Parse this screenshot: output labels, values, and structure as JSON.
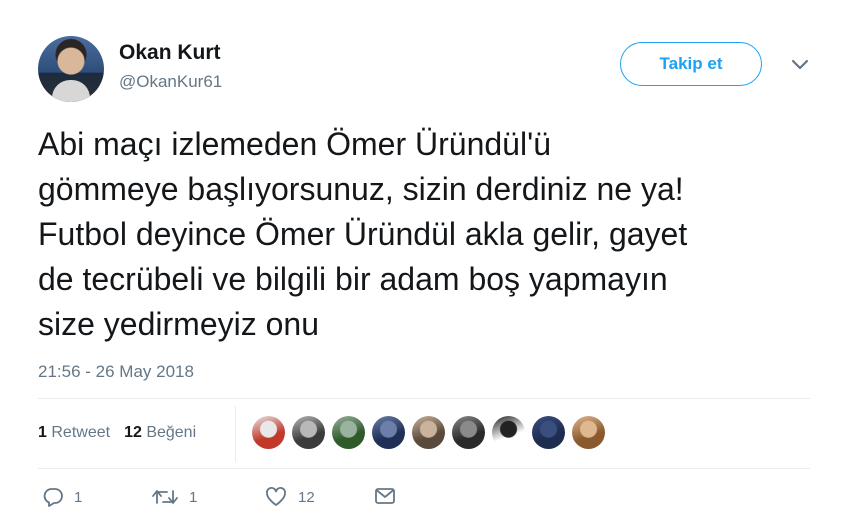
{
  "user": {
    "name": "Okan Kurt",
    "handle": "@OkanKur61"
  },
  "follow_button_label": "Takip et",
  "tweet": {
    "text": "Abi maçı izlemeden Ömer Üründül'ü\ngömmeye başlıyorsunuz, sizin derdiniz ne ya!\nFutbol deyince Ömer Üründül akla gelir, gayet\nde tecrübeli ve bilgili bir adam boş yapmayın\nsize yedirmeyiz onu",
    "timestamp": "21:56 - 26 May 2018"
  },
  "stats": {
    "retweet_count": "1",
    "retweet_label": "Retweet",
    "like_count": "12",
    "like_label": "Beğeni"
  },
  "liker_avatars": [
    {
      "color_a": "#c0392b",
      "color_b": "#e8e8e8"
    },
    {
      "color_a": "#3b3b3b",
      "color_b": "#b8b8b8"
    },
    {
      "color_a": "#2f5a2a",
      "color_b": "#9ab3a0"
    },
    {
      "color_a": "#1f2f55",
      "color_b": "#6d7fa8"
    },
    {
      "color_a": "#5a4a3c",
      "color_b": "#c9b39c"
    },
    {
      "color_a": "#2a2a2a",
      "color_b": "#8a8a8a"
    },
    {
      "color_a": "#ffffff",
      "color_b": "#222222"
    },
    {
      "color_a": "#1d2c4f",
      "color_b": "#3a4f80"
    },
    {
      "color_a": "#8a5a2e",
      "color_b": "#e0b890"
    }
  ],
  "actions": {
    "reply_count": "1",
    "retweet_count": "1",
    "like_count": "12"
  },
  "colors": {
    "accent": "#1da1f2",
    "secondary_text": "#657786",
    "divider": "#e6ecf0"
  }
}
